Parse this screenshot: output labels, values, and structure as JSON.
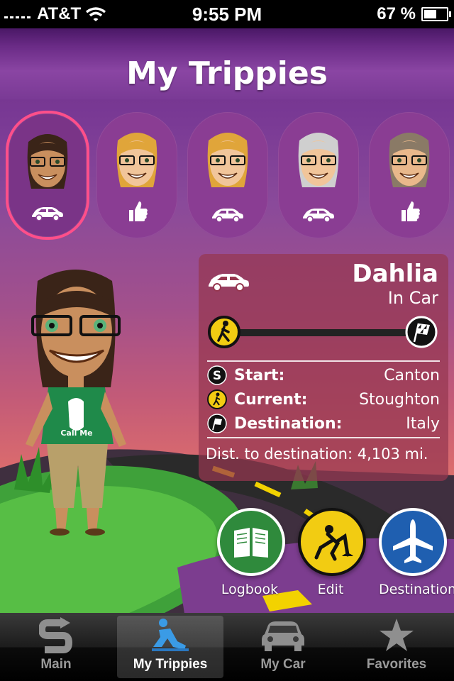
{
  "status_bar": {
    "carrier": "AT&T",
    "time": "9:55 PM",
    "battery": "67 %",
    "battery_level": 0.67
  },
  "title": "My Trippies",
  "trippies": [
    {
      "id": "dahlia",
      "status": "car",
      "selected": true,
      "hair": "#3a2418",
      "skin": "#c98f5e"
    },
    {
      "id": "trippie-2",
      "status": "thumbs-up",
      "selected": false,
      "hair": "#e0a53a",
      "skin": "#f1c59a"
    },
    {
      "id": "trippie-3",
      "status": "car",
      "selected": false,
      "hair": "#e0a53a",
      "skin": "#f1c59a"
    },
    {
      "id": "trippie-4",
      "status": "car",
      "selected": false,
      "hair": "#cfcfcf",
      "skin": "#f1c59a"
    },
    {
      "id": "trippie-5",
      "status": "thumbs-up",
      "selected": false,
      "hair": "#8a7a66",
      "skin": "#e9b88b"
    }
  ],
  "detail": {
    "name": "Dahlia",
    "state": "In Car",
    "progress": 0.0,
    "start_label": "Start:",
    "start_value": "Canton",
    "current_label": "Current:",
    "current_value": "Stoughton",
    "destination_label": "Destination:",
    "destination_value": "Italy",
    "distance_text": "Dist. to destination: 4,103 mi."
  },
  "avatar": {
    "shirt_text": "Call Me"
  },
  "actions": [
    {
      "label": "Logbook",
      "icon": "book-icon",
      "color": "#2f8a3c"
    },
    {
      "label": "Edit",
      "icon": "construction-worker-icon",
      "color": "#f2cc12"
    },
    {
      "label": "Destination",
      "icon": "airplane-icon",
      "color": "#1f5fb0"
    }
  ],
  "tabs": [
    {
      "label": "Main",
      "icon": "s-arrow-icon",
      "active": false
    },
    {
      "label": "My Trippies",
      "icon": "trippie-runner-icon",
      "active": true
    },
    {
      "label": "My Car",
      "icon": "car-icon",
      "active": false
    },
    {
      "label": "Favorites",
      "icon": "star-icon",
      "active": false
    }
  ]
}
